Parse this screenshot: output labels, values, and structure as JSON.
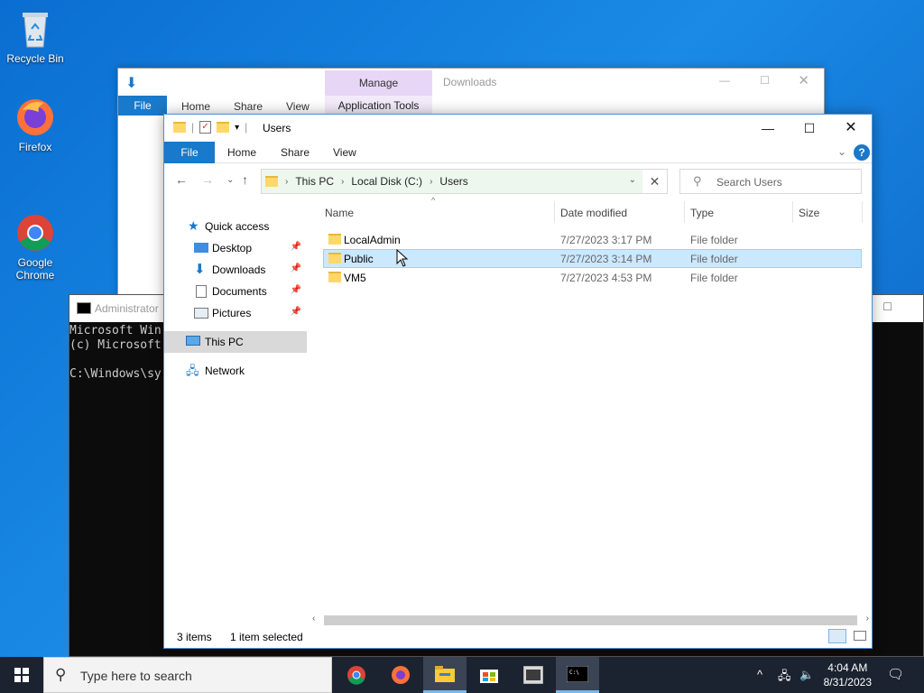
{
  "desktop": {
    "icons": [
      {
        "label": "Recycle Bin"
      },
      {
        "label": "Firefox"
      },
      {
        "label": "Google\nChrome"
      }
    ]
  },
  "back_window": {
    "manage_tab": "Manage",
    "title": "Downloads",
    "ribbon": {
      "file": "File",
      "home": "Home",
      "share": "Share",
      "view": "View",
      "app_tools": "Application Tools"
    }
  },
  "cmd": {
    "title": "Administrator",
    "lines": "Microsoft Win\n(c) Microsoft\n\nC:\\Windows\\sy"
  },
  "explorer": {
    "title": "Users",
    "ribbon": {
      "file": "File",
      "home": "Home",
      "share": "Share",
      "view": "View"
    },
    "breadcrumb": [
      "This PC",
      "Local Disk (C:)",
      "Users"
    ],
    "search_placeholder": "Search Users",
    "nav": {
      "quick_access": "Quick access",
      "desktop": "Desktop",
      "downloads": "Downloads",
      "documents": "Documents",
      "pictures": "Pictures",
      "this_pc": "This PC",
      "network": "Network"
    },
    "columns": {
      "name": "Name",
      "date": "Date modified",
      "type": "Type",
      "size": "Size"
    },
    "rows": [
      {
        "name": "LocalAdmin",
        "date": "7/27/2023 3:17 PM",
        "type": "File folder"
      },
      {
        "name": "Public",
        "date": "7/27/2023 3:14 PM",
        "type": "File folder"
      },
      {
        "name": "VM5",
        "date": "7/27/2023 4:53 PM",
        "type": "File folder"
      }
    ],
    "status": {
      "count": "3 items",
      "selected": "1 item selected"
    }
  },
  "taskbar": {
    "search_placeholder": "Type here to search",
    "time": "4:04 AM",
    "date": "8/31/2023"
  },
  "colors": {
    "accent": "#1979ca",
    "selection": "#cce8ff",
    "taskbar": "#1b2330"
  }
}
